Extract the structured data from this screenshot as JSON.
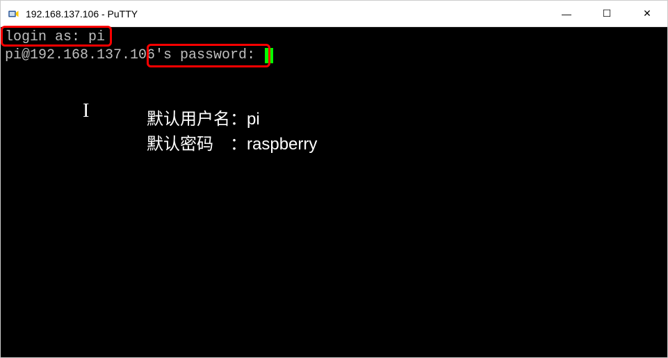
{
  "window": {
    "title": "192.168.137.106 - PuTTY"
  },
  "terminal": {
    "line1_prompt": "login as: ",
    "line1_input": "pi",
    "line2_prefix": "pi@192.168.137.106's ",
    "line2_prompt": "password: "
  },
  "annotation": {
    "username_label": "默认用户名：",
    "username_value": "pi",
    "password_label": "默认密码　：",
    "password_value": "raspberry"
  },
  "controls": {
    "minimize": "—",
    "maximize": "☐",
    "close": "✕"
  }
}
